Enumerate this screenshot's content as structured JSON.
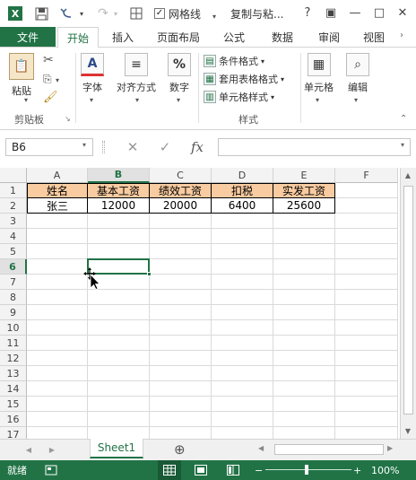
{
  "title_bar": {
    "icons": [
      "excel-app-icon",
      "save-icon",
      "undo-icon",
      "redo-icon",
      "touch-mode-icon"
    ],
    "gridlines_checkbox_label": "网格线",
    "title": "复制与粘...",
    "help": "?",
    "ribbon_display": "▣",
    "minimize": "—",
    "restore": "□",
    "close": "✕"
  },
  "tabs": [
    "文件",
    "开始",
    "插入",
    "页面布局",
    "公式",
    "数据",
    "审阅",
    "视图"
  ],
  "active_tab": "开始",
  "ribbon": {
    "clipboard": {
      "paste_label": "粘贴",
      "group_label": "剪贴板"
    },
    "font_label": "字体",
    "align_label": "对齐方式",
    "number_label": "数字",
    "styles": {
      "conditional": "条件格式",
      "table_format": "套用表格格式",
      "cell_styles": "单元格样式",
      "group_label": "样式"
    },
    "cells_label": "单元格",
    "edit_label": "编辑"
  },
  "formula_bar": {
    "name_box": "B6",
    "cancel": "✕",
    "enter": "✓",
    "fx": "fx",
    "formula": ""
  },
  "grid": {
    "columns": [
      "A",
      "B",
      "C",
      "D",
      "E",
      "F"
    ],
    "rows": [
      "1",
      "2",
      "3",
      "4",
      "5",
      "6",
      "7",
      "8",
      "9",
      "10",
      "11",
      "12",
      "13",
      "14",
      "15",
      "16",
      "17"
    ],
    "selected_cell": "B6",
    "header_row": [
      "姓名",
      "基本工资",
      "绩效工资",
      "扣税",
      "实发工资"
    ],
    "data_row": [
      "张三",
      "12000",
      "20000",
      "6400",
      "25600"
    ],
    "header_fill": "#f8cba0"
  },
  "sheet_bar": {
    "sheet_name": "Sheet1",
    "add_sheet": "⊕"
  },
  "status_bar": {
    "status": "就绪",
    "zoom": "100%",
    "accent": "#217346"
  }
}
